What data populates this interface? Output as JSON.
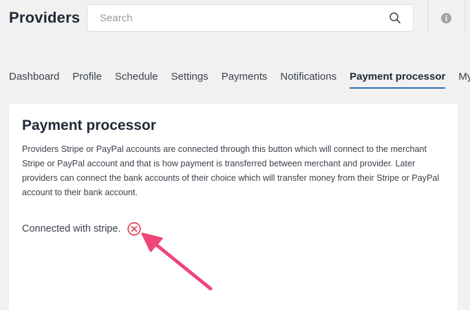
{
  "header": {
    "title": "Providers",
    "search_placeholder": "Search",
    "search_icon": "search-icon",
    "info_icon": "info-icon"
  },
  "tabs": [
    {
      "label": "Dashboard",
      "active": false
    },
    {
      "label": "Profile",
      "active": false
    },
    {
      "label": "Schedule",
      "active": false
    },
    {
      "label": "Settings",
      "active": false
    },
    {
      "label": "Payments",
      "active": false
    },
    {
      "label": "Notifications",
      "active": false
    },
    {
      "label": "Payment processor",
      "active": true
    },
    {
      "label": "My d",
      "active": false
    }
  ],
  "card": {
    "title": "Payment processor",
    "description": "Providers Stripe or PayPal accounts are connected through this button which will connect to the merchant Stripe or PayPal account and that is how payment is transferred between merchant and provider. Later providers can connect the bank accounts of their choice which will transfer money from their Stripe or PayPal account to their bank account.",
    "status_text": "Connected with stripe.",
    "disconnect_icon": "close-circle-icon"
  },
  "colors": {
    "accent": "#2a6fb5",
    "danger": "#e0455a",
    "annotation_arrow": "#f0457a"
  }
}
